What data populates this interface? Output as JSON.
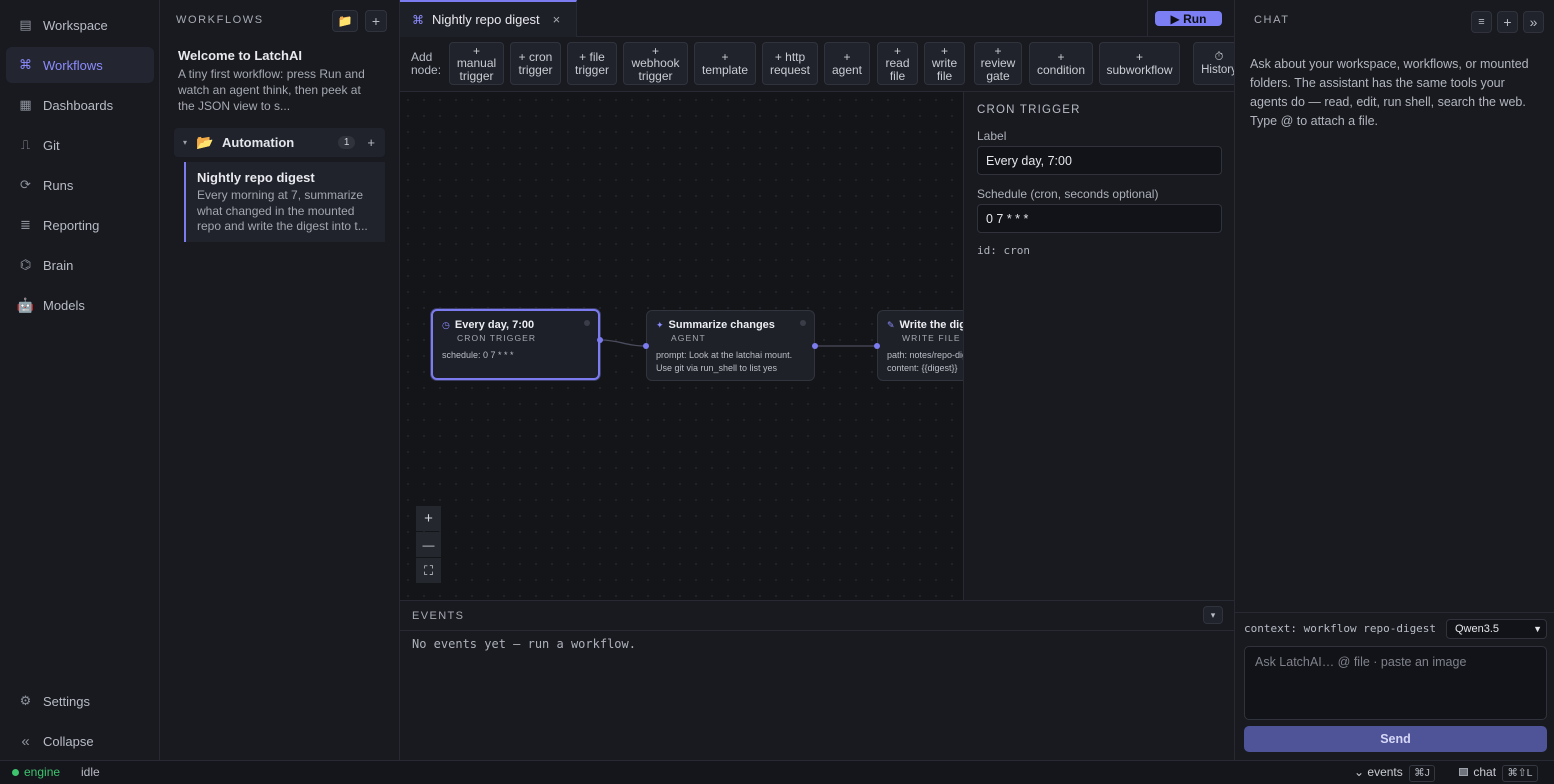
{
  "nav": {
    "items": [
      {
        "icon": "▤",
        "label": "Workspace"
      },
      {
        "icon": "⌘",
        "label": "Workflows"
      },
      {
        "icon": "▦",
        "label": "Dashboards"
      },
      {
        "icon": "⎍",
        "label": "Git"
      },
      {
        "icon": "⟳",
        "label": "Runs"
      },
      {
        "icon": "≣",
        "label": "Reporting"
      },
      {
        "icon": "⌬",
        "label": "Brain"
      },
      {
        "icon": "🤖",
        "label": "Models"
      }
    ],
    "settings": {
      "icon": "⚙",
      "label": "Settings"
    },
    "collapse": {
      "icon": "«",
      "label": "Collapse"
    }
  },
  "workflows_panel": {
    "header": "WORKFLOWS",
    "folder_icon": "📁",
    "add_icon": "+",
    "welcome": {
      "title": "Welcome to LatchAI",
      "desc": "A tiny first workflow: press Run and watch an agent think, then peek at the JSON view to s..."
    },
    "folder": {
      "caret": "▾",
      "icon": "📂",
      "name": "Automation",
      "count": "1",
      "add": "+"
    },
    "item": {
      "title": "Nightly repo digest",
      "desc": "Every morning at 7, summarize what changed in the mounted repo and write the digest into t..."
    }
  },
  "tab": {
    "icon": "⌘",
    "title": "Nightly repo digest",
    "close": "×"
  },
  "run_button": "▶ Run",
  "toolbar": {
    "add_label": "Add\nnode:",
    "buttons": [
      "+\nmanual\ntrigger",
      "+ cron\ntrigger",
      "+ file\ntrigger",
      "+\nwebhook\ntrigger",
      "+\ntemplate",
      "+ http\nrequest",
      "+\nagent",
      "+\nread\nfile",
      "+\nwrite\nfile",
      "+\nreview\ngate",
      "+\ncondition",
      "+\nsubworkflow",
      "⏱\nHistory"
    ]
  },
  "nodes": [
    {
      "icon": "◷",
      "title": "Every day, 7:00",
      "kind": "CRON TRIGGER",
      "body": "schedule: 0 7 * * *"
    },
    {
      "icon": "✦",
      "title": "Summarize changes",
      "kind": "AGENT",
      "body": "prompt: Look at the latchai mount.\nUse git via run_shell to list yes"
    },
    {
      "icon": "✎",
      "title": "Write the digest",
      "kind": "WRITE FILE",
      "body": "path: notes/repo-digest.md\ncontent: {{digest}}"
    }
  ],
  "zoom": {
    "in": "+",
    "out": "—",
    "fit": "⛶"
  },
  "inspector": {
    "header": "CRON TRIGGER",
    "label_label": "Label",
    "label_value": "Every day, 7:00",
    "schedule_label": "Schedule (cron, seconds optional)",
    "schedule_value": "0 7 * * *",
    "id": "id: cron"
  },
  "events": {
    "header": "EVENTS",
    "toggle": "▾",
    "empty": "No events yet — run a workflow."
  },
  "chat": {
    "header": "CHAT",
    "buttons": [
      "≡",
      "+",
      "»"
    ],
    "intro": "Ask about your workspace, workflows, or mounted folders. The assistant has the same tools your agents do — read, edit, run shell, search the web. Type @ to attach a file.",
    "context": "context: workflow repo-digest",
    "model": "Qwen3.5",
    "input_placeholder": "Ask LatchAI… @ file · paste an image",
    "send": "Send"
  },
  "status": {
    "engine": "engine",
    "state": "idle",
    "events_toggle": "⌄ events",
    "events_kbd": "⌘J",
    "chat_toggle": "chat",
    "chat_kbd": "⌘⇧L"
  },
  "colors": {
    "accent": "#7c7cf0",
    "status_ok": "#3ec46d",
    "background": "#16181d"
  }
}
